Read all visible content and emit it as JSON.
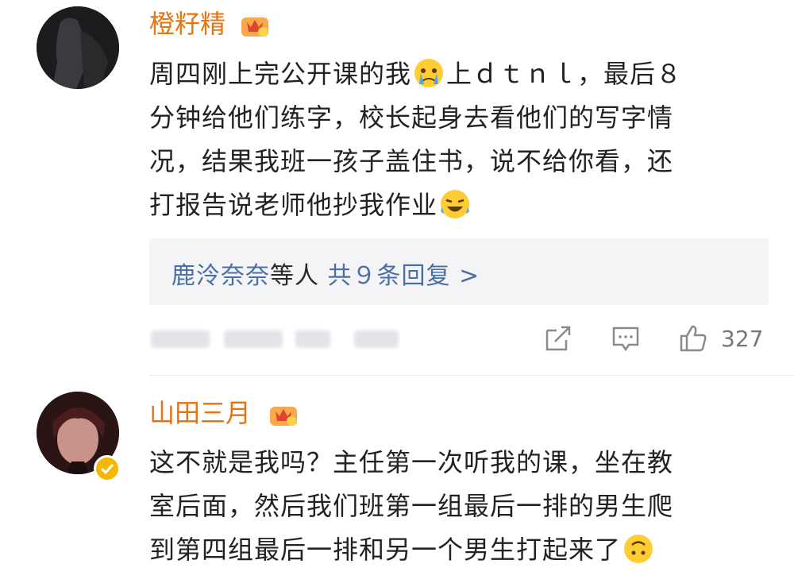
{
  "comments": [
    {
      "username": "橙籽精",
      "lines": [
        [
          "周四刚上完公开课的我",
          "上ｄｔｎｌ，最后８"
        ],
        [
          "分钟给他们练字，校长起身去看他们的写字情"
        ],
        [
          "况，结果我班一孩子盖住书，说不给你看，还"
        ],
        [
          "打报告说老师他抄我作业"
        ]
      ],
      "emojis": [
        "crying-emoji",
        "laughing-crying-emoji"
      ],
      "replies": {
        "users": "鹿泠奈奈",
        "middle": "等人",
        "count_text": "共９条回复",
        "arrow": ">"
      },
      "like_count": "327"
    },
    {
      "username": "山田三月",
      "lines": [
        [
          "这不就是我吗？主任第一次听我的课，坐在教"
        ],
        [
          "室后面，然后我们班第一组最后一排的男生爬"
        ],
        [
          "到第四组最后一排和另一个男生打起来了"
        ]
      ],
      "emojis": [
        "upside-down-face-emoji"
      ]
    }
  ],
  "colors": {
    "username": "#e8730f",
    "reply_link": "#4a6fa5",
    "reply_bg": "#f4f4f6",
    "verified": "#f5b800"
  }
}
